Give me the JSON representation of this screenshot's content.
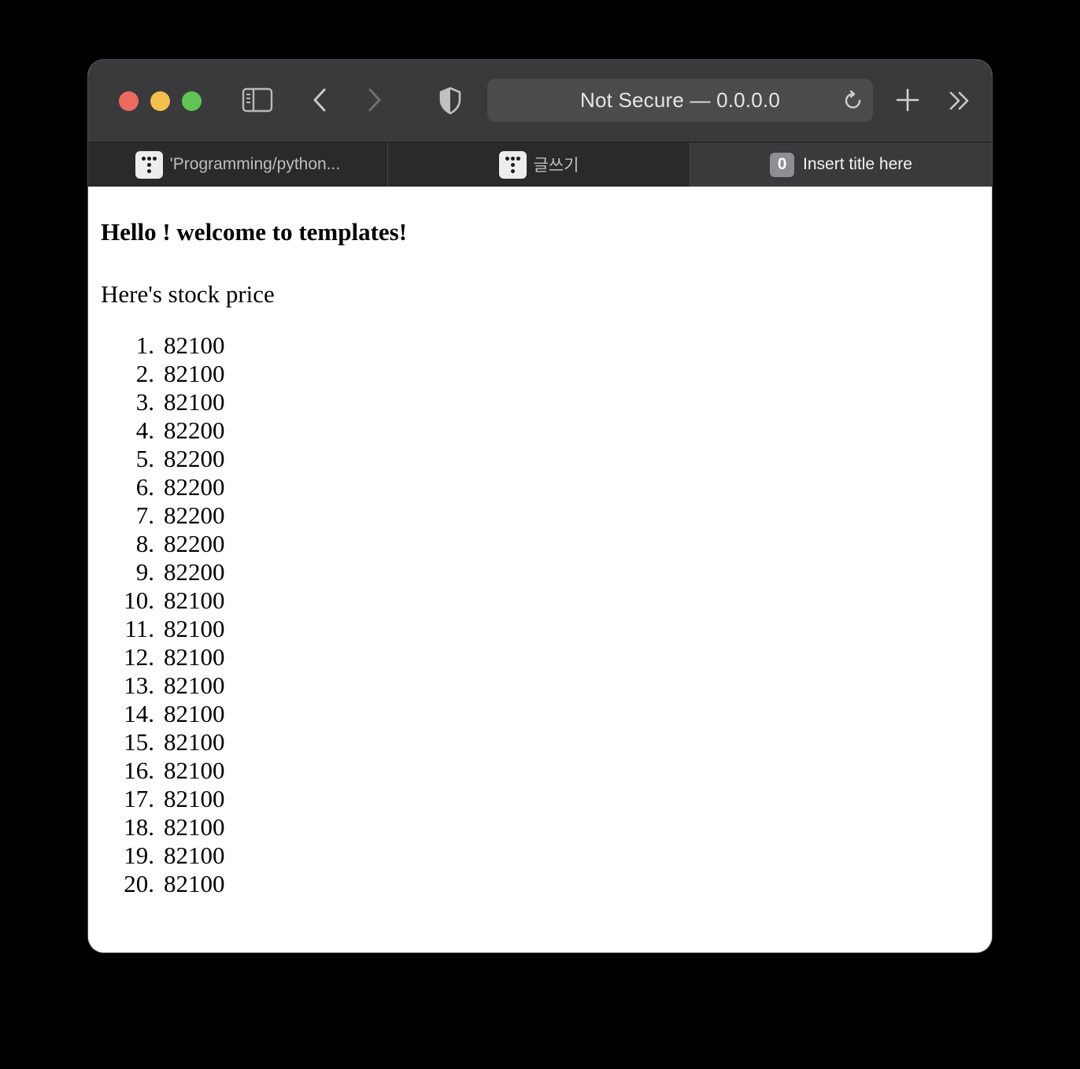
{
  "toolbar": {
    "address": "Not Secure — 0.0.0.0",
    "icons": [
      "sidebar-icon",
      "back-icon",
      "forward-icon",
      "shield-icon",
      "reload-icon",
      "new-tab-icon",
      "more-tabs-icon"
    ]
  },
  "tabs": [
    {
      "label": "'Programming/python...",
      "icon": "tistory-favicon-icon"
    },
    {
      "label": "글쓰기",
      "icon": "tistory-favicon-icon"
    },
    {
      "label": "Insert title here",
      "badge": "0",
      "active": true
    }
  ],
  "page": {
    "heading": "Hello ! welcome to templates!",
    "subtitle": "Here's stock price",
    "prices": [
      {
        "num": "1.",
        "value": "82100"
      },
      {
        "num": "2.",
        "value": "82100"
      },
      {
        "num": "3.",
        "value": "82100"
      },
      {
        "num": "4.",
        "value": "82200"
      },
      {
        "num": "5.",
        "value": "82200"
      },
      {
        "num": "6.",
        "value": "82200"
      },
      {
        "num": "7.",
        "value": "82200"
      },
      {
        "num": "8.",
        "value": "82200"
      },
      {
        "num": "9.",
        "value": "82200"
      },
      {
        "num": "10.",
        "value": "82100"
      },
      {
        "num": "11.",
        "value": "82100"
      },
      {
        "num": "12.",
        "value": "82100"
      },
      {
        "num": "13.",
        "value": "82100"
      },
      {
        "num": "14.",
        "value": "82100"
      },
      {
        "num": "15.",
        "value": "82100"
      },
      {
        "num": "16.",
        "value": "82100"
      },
      {
        "num": "17.",
        "value": "82100"
      },
      {
        "num": "18.",
        "value": "82100"
      },
      {
        "num": "19.",
        "value": "82100"
      },
      {
        "num": "20.",
        "value": "82100"
      }
    ]
  }
}
